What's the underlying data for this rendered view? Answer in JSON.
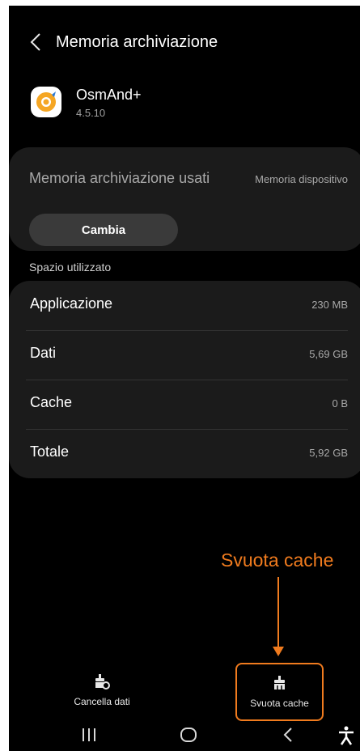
{
  "header": {
    "title": "Memoria archiviazione",
    "back_icon": "chevron-left-icon"
  },
  "app": {
    "name": "OsmAnd+",
    "version": "4.5.10",
    "icon": "osmand-logo-icon"
  },
  "storage": {
    "label": "Memoria archiviazione usati",
    "value": "Memoria dispositivo",
    "change_label": "Cambia"
  },
  "usage": {
    "section_label": "Spazio utilizzato",
    "rows": [
      {
        "label": "Applicazione",
        "value": "230 MB"
      },
      {
        "label": "Dati",
        "value": "5,69 GB"
      },
      {
        "label": "Cache",
        "value": "0 B"
      },
      {
        "label": "Totale",
        "value": "5,92 GB"
      }
    ]
  },
  "annotation": {
    "text": "Svuota cache",
    "color": "#f07b1e"
  },
  "bottom_actions": {
    "clear_data": "Cancella dati",
    "clear_cache": "Svuota cache"
  },
  "nav": {
    "recents": "recents-icon",
    "home": "home-icon",
    "back": "back-icon",
    "accessibility": "accessibility-icon"
  }
}
